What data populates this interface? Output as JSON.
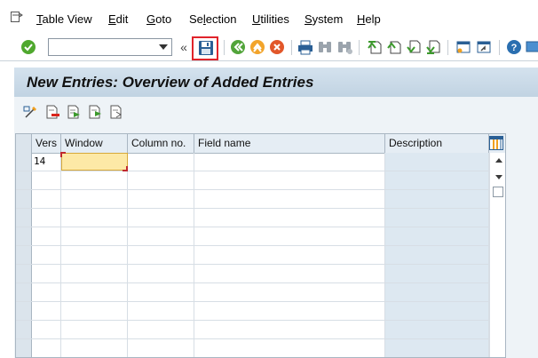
{
  "menu": {
    "items": [
      {
        "label": "Table View",
        "u": "T",
        "rest": "able View"
      },
      {
        "label": "Edit",
        "u": "E",
        "rest": "dit"
      },
      {
        "label": "Goto",
        "u": "G",
        "rest": "oto"
      },
      {
        "label": "Selection",
        "pre": "Se",
        "u": "l",
        "rest": "ection"
      },
      {
        "label": "Utilities",
        "u": "U",
        "rest": "tilities"
      },
      {
        "label": "System",
        "u": "S",
        "rest": "ystem"
      },
      {
        "label": "Help",
        "u": "H",
        "rest": "elp"
      }
    ]
  },
  "toolbar": {
    "command_field_value": "",
    "collapse_glyph": "«"
  },
  "title": "New Entries: Overview of Added Entries",
  "table": {
    "columns": [
      "Vers",
      "Window",
      "Column no.",
      "Field name",
      "Description"
    ],
    "rows": [
      {
        "vers": "14",
        "window": "",
        "column_no": "",
        "field_name": "",
        "description": ""
      }
    ]
  },
  "colors": {
    "title_bar": "#c9d9e7",
    "active_cell": "#fde9a6",
    "highlight_border": "#e0242b",
    "description_column": "#dde8f1"
  }
}
